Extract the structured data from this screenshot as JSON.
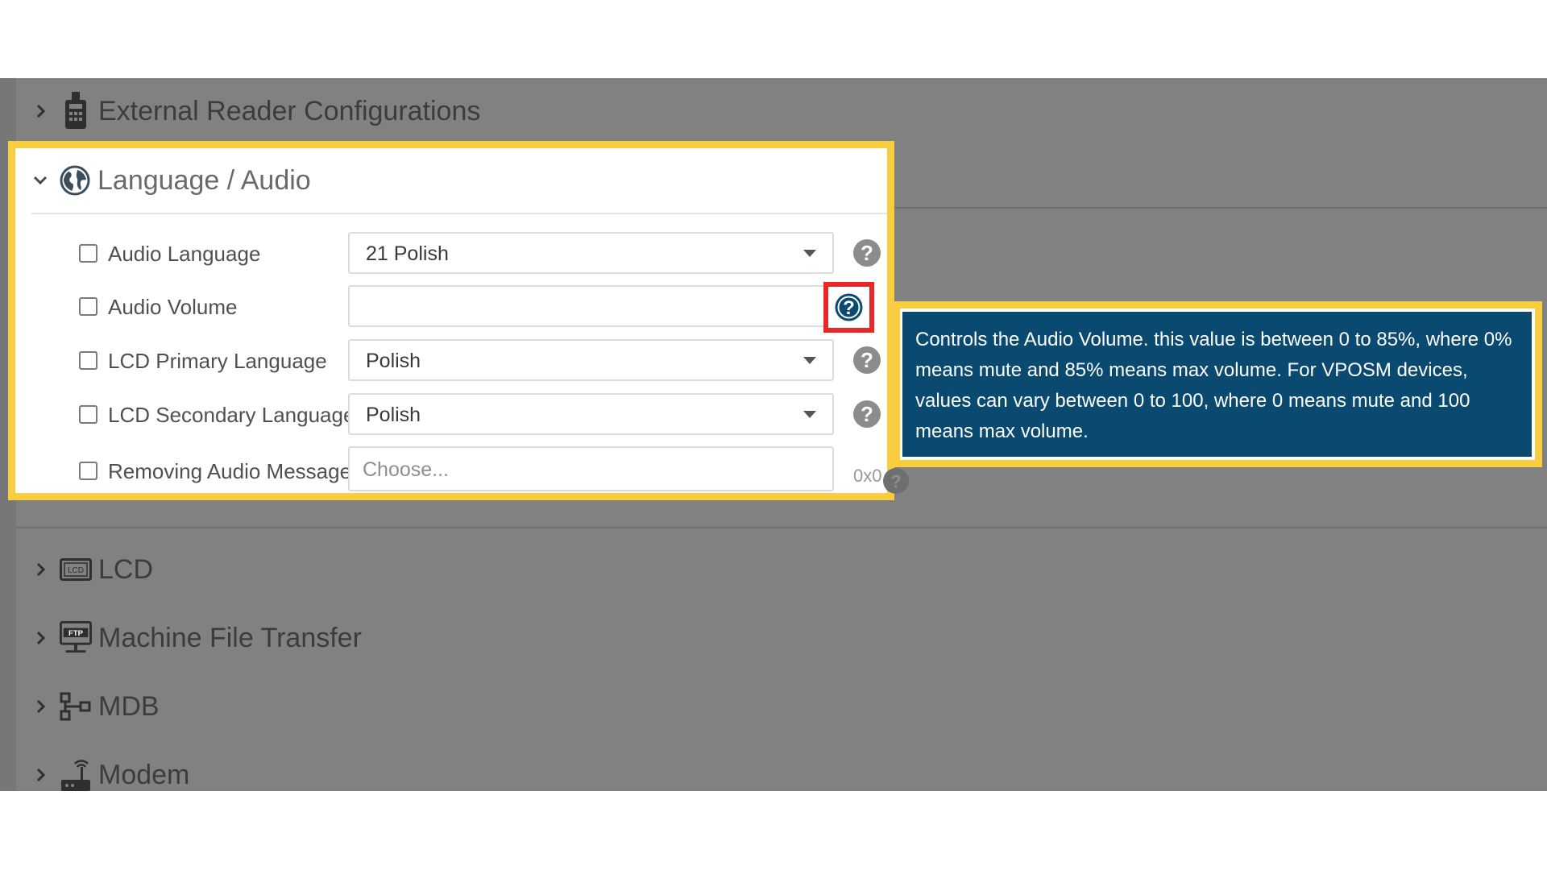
{
  "sections": {
    "external_reader": "External Reader Configurations",
    "language_audio": "Language / Audio",
    "lcd": "LCD",
    "machine_file_transfer": "Machine File Transfer",
    "mdb": "MDB",
    "modem": "Modem"
  },
  "fields": [
    {
      "label": "Audio Language",
      "value": "21 Polish",
      "type": "select"
    },
    {
      "label": "Audio Volume",
      "value": "",
      "type": "input"
    },
    {
      "label": "LCD Primary Language",
      "value": "Polish",
      "type": "select"
    },
    {
      "label": "LCD Secondary Language",
      "value": "Polish",
      "type": "select"
    },
    {
      "label": "Removing Audio Message",
      "placeholder": "Choose...",
      "suffix": "0x0",
      "type": "multiselect"
    }
  ],
  "tooltip": {
    "text": "Controls the Audio Volume. this value is between 0 to 85%, where 0% means mute and 85% means max volume. For VPOSM devices, values can vary between 0 to 100, where 0 means mute and 100 means max volume."
  },
  "colors": {
    "highlight": "#f8cd3f",
    "focus_box": "#ea2626",
    "tooltip_bg": "#0b4a70",
    "help_active": "#0b4a70",
    "help_inactive": "#8c8c8c",
    "overlay": "#818181"
  },
  "icons": {
    "external_reader": "card-reader-icon",
    "language_audio": "globe-icon",
    "lcd": "lcd-icon",
    "machine_file_transfer": "ftp-icon",
    "mdb": "mdb-icon",
    "modem": "modem-icon",
    "help": "question-circle-icon"
  }
}
